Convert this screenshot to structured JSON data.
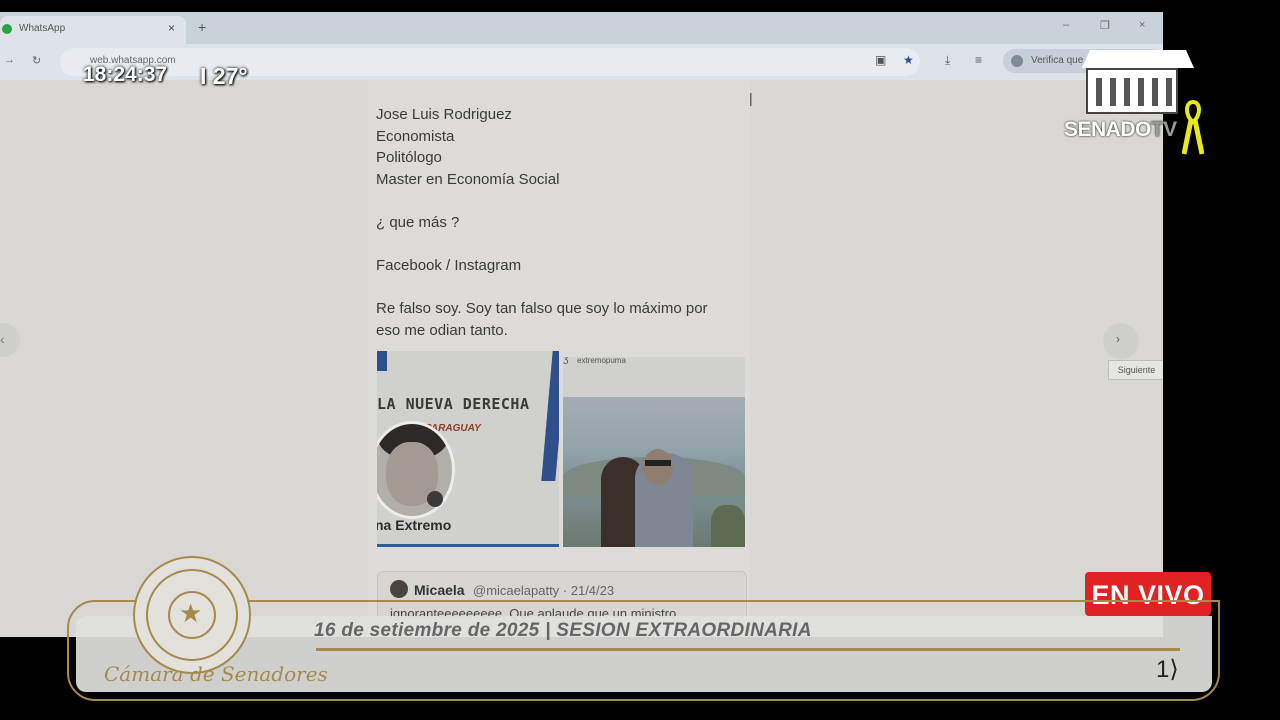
{
  "overlay": {
    "clock": "18:24:37",
    "temperature": "I 27°",
    "channel_logo": {
      "brand": "SENADO",
      "suffix": "TV"
    },
    "live_badge": "EN VIVO",
    "lower_third": {
      "date_session": "16 de setiembre de 2025   |   SESION EXTRAORDINARIA",
      "chamber": "Cámara de Senadores",
      "mark": "1⟩"
    }
  },
  "browser": {
    "tab_title": "WhatsApp",
    "tab_close": "×",
    "new_tab": "+",
    "window_controls": [
      "–",
      "❐",
      "×"
    ],
    "url": "web.whatsapp.com",
    "profile_label": "Verifica que",
    "nav": {
      "back": "←",
      "forward": "→",
      "reload": "↻"
    }
  },
  "viewer": {
    "prev_icon": "‹",
    "next_icon": "›",
    "next_tooltip": "Siguiente",
    "caret": "|",
    "post_lines": [
      "Jose Luis Rodriguez",
      "Economista",
      "Politólogo",
      "Master en Economía Social",
      "",
      "¿ que más ?",
      "",
      "Facebook / Instagram",
      "",
      "Re falso soy. Soy tan falso que soy lo máximo por",
      "eso me odian tanto."
    ],
    "card_left": {
      "headline": "LA NUEVA DERECHA",
      "subhead": "PARAGUAY",
      "handle": "na Extremo"
    },
    "card_right": {
      "account": "extremopuma"
    },
    "quote": {
      "name": "Micaela",
      "handle": "@micaelapatty · 21/4/23",
      "text": "ignoranteeeeeeeee. Que aplaude que un ministro"
    }
  },
  "colors": {
    "gold": "#a58a4c",
    "live_red": "#e02222",
    "ribbon_yellow": "#e8e81e"
  }
}
